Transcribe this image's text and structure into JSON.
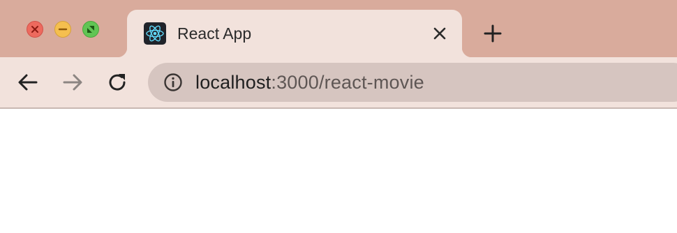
{
  "window": {
    "controls": {
      "close_color": "#ed6a5e",
      "minimize_color": "#f5bf4f",
      "maximize_color": "#61c554"
    }
  },
  "tabs": [
    {
      "title": "React App",
      "favicon": "react-logo-icon",
      "active": true
    }
  ],
  "toolbar": {
    "back_icon": "arrow-left-icon",
    "forward_icon": "arrow-right-icon",
    "forward_enabled": false,
    "reload_icon": "reload-icon",
    "new_tab_icon": "plus-icon"
  },
  "address_bar": {
    "security_icon": "info-icon",
    "host": "localhost",
    "rest": ":3000/react-movie"
  },
  "colors": {
    "tabstrip_bg": "#d9ab9c",
    "active_tab_bg": "#f2e2dc",
    "omnibox_bg": "#d6c5c0"
  }
}
